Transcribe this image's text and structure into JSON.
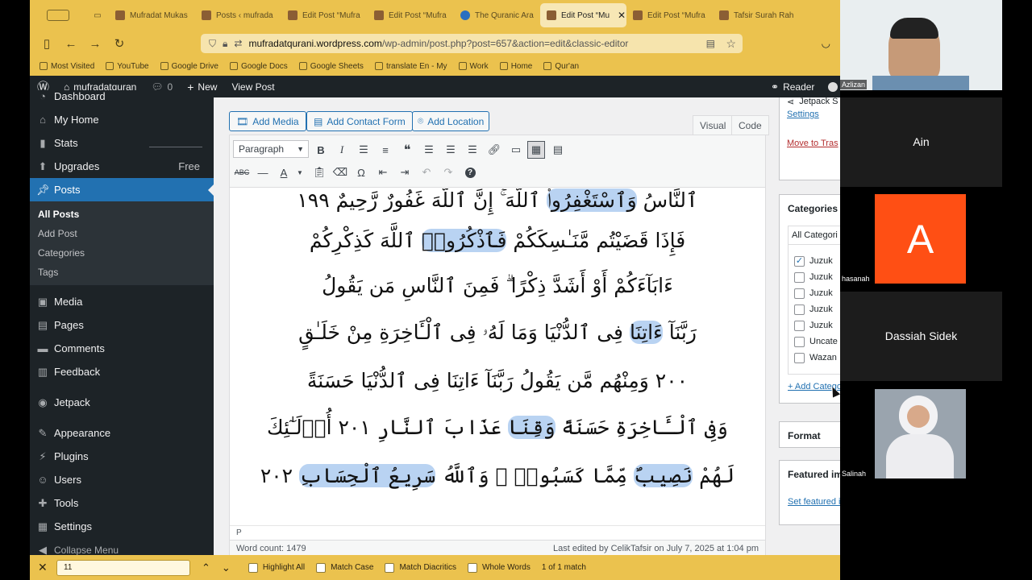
{
  "browser": {
    "tabs": [
      {
        "title": "Mufradat Mukas"
      },
      {
        "title": "Posts ‹ mufrada"
      },
      {
        "title": "Edit Post “Mufra"
      },
      {
        "title": "Edit Post “Mufra"
      },
      {
        "title": "The Quranic Ara"
      },
      {
        "title": "Edit Post “Mu",
        "active": true,
        "close": "✕"
      },
      {
        "title": "Edit Post “Mufra"
      },
      {
        "title": "Tafsir Surah Rah"
      }
    ],
    "url_host": "mufradatqurani.wordpress.com",
    "url_path": "/wp-admin/post.php?post=657&action=edit&classic-editor",
    "bookmarks": [
      "Most Visited",
      "YouTube",
      "Google Drive",
      "Google Docs",
      "Google Sheets",
      "translate En - My",
      "Work",
      "Home",
      "Qur'an"
    ]
  },
  "adminbar": {
    "site": "mufradatquran",
    "comments": "0",
    "new": "New",
    "view_post": "View Post",
    "reader": "Reader",
    "user": "Azlizan"
  },
  "sidebar": {
    "items": [
      {
        "label": "Dashboard",
        "icon": "dashboard-icon"
      },
      {
        "label": "My Home",
        "icon": "home-icon"
      },
      {
        "label": "Stats",
        "icon": "stats-icon"
      },
      {
        "label": "Upgrades",
        "icon": "upgrades-icon",
        "badge": "Free"
      },
      {
        "label": "Posts",
        "icon": "pin-icon",
        "current": true
      }
    ],
    "submenu": [
      "All Posts",
      "Add Post",
      "Categories",
      "Tags"
    ],
    "items2": [
      {
        "label": "Media",
        "icon": "media-icon"
      },
      {
        "label": "Pages",
        "icon": "pages-icon"
      },
      {
        "label": "Comments",
        "icon": "comments-icon"
      },
      {
        "label": "Feedback",
        "icon": "feedback-icon"
      },
      {
        "label": "Jetpack",
        "icon": "jetpack-icon"
      },
      {
        "label": "Appearance",
        "icon": "appearance-icon"
      },
      {
        "label": "Plugins",
        "icon": "plugins-icon"
      },
      {
        "label": "Users",
        "icon": "users-icon"
      },
      {
        "label": "Tools",
        "icon": "tools-icon"
      },
      {
        "label": "Settings",
        "icon": "settings-icon"
      },
      {
        "label": "Collapse Menu",
        "icon": "collapse-icon"
      }
    ]
  },
  "editor": {
    "add_media": "Add Media",
    "add_contact_form": "Add Contact Form",
    "add_location": "Add Location",
    "tab_visual": "Visual",
    "tab_code": "Code",
    "format_select": "Paragraph",
    "path": "P",
    "word_count": "Word count: 1479",
    "last_edited": "Last edited by CelikTafsir on July 7, 2025 at 1:04 pm",
    "ayat": [
      "ٱلنَّاسُ وَٱسْتَغْفِرُوا۟ ٱللَّهَ ۚ إِنَّ ٱللَّهَ غَفُورٌ رَّحِيمٌ ١٩٩",
      "فَإِذَا قَضَيْتُم مَّنَـٰسِكَكُمْ فَٱذْكُرُوا۟ ٱللَّهَ كَذِكْرِكُمْ",
      "ءَابَآءَكُمْ أَوْ أَشَدَّ ذِكْرًا ۗ فَمِنَ ٱلنَّاسِ مَن يَقُولُ",
      "رَبَّنَآ ءَاتِنَا فِى ٱلدُّنْيَا وَمَا لَهُۥ فِى ٱلْـَٔاخِرَةِ مِنْ خَلَـٰقٍ",
      "٢٠٠ وَمِنْهُم مَّن يَقُولُ رَبَّنَآ ءَاتِنَا فِى ٱلدُّنْيَا حَسَنَةً",
      "وَفِى ٱلْـَٔاخِرَةِ حَسَنَةً وَقِنَا عَذَابَ ٱلنَّارِ ٢٠١ أُو۟لَـٰٓئِكَ",
      "لَهُمْ نَصِيبٌ مِّمَّا كَسَبُوا۟ ۚ وَٱللَّهُ سَرِيعُ ٱلْحِسَابِ ٢٠٢"
    ]
  },
  "rightcol": {
    "jetpack": "Jetpack S",
    "settings": "Settings",
    "trash": "Move to Tras",
    "categories_title": "Categories",
    "all_categories": "All Categori",
    "categories": [
      {
        "label": "Juzuk",
        "checked": true
      },
      {
        "label": "Juzuk",
        "checked": false
      },
      {
        "label": "Juzuk",
        "checked": false
      },
      {
        "label": "Juzuk",
        "checked": false
      },
      {
        "label": "Juzuk",
        "checked": false
      },
      {
        "label": "Uncate",
        "checked": false
      },
      {
        "label": "Wazan",
        "checked": false
      }
    ],
    "add_category": "+ Add Category",
    "format_title": "Format",
    "featured_title": "Featured im",
    "set_featured": "Set featured image"
  },
  "findbar": {
    "query": "11",
    "highlight_all": "Highlight All",
    "match_case": "Match Case",
    "match_diacritics": "Match Diacritics",
    "whole_words": "Whole Words",
    "result": "1 of 1 match"
  },
  "video": {
    "participants": [
      "Azlizan",
      "Ain",
      "hasanah",
      "Dassiah Sidek",
      "Salinah"
    ],
    "avatar_letter": "A",
    "avatar_color": "#ff4f14"
  }
}
